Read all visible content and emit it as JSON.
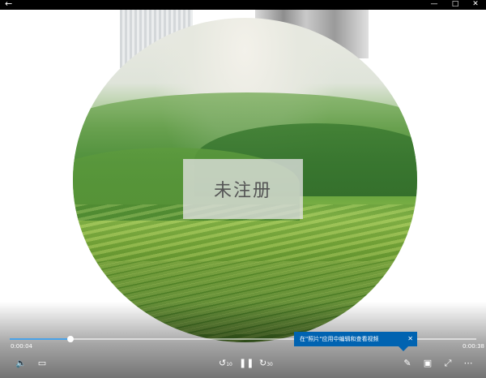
{
  "window": {
    "back_icon": "back-arrow-icon",
    "controls": [
      "minimize-icon",
      "maximize-icon",
      "close-icon"
    ]
  },
  "video": {
    "watermark_text": "未注册"
  },
  "player": {
    "current_time": "0:00:04",
    "total_time": "0:00:38",
    "progress": 0.13,
    "skip_back_label": "10",
    "skip_forward_label": "30"
  },
  "toast": {
    "text": "在\"照片\"应用中编辑和查看视频"
  },
  "colors": {
    "accent": "#0063b1",
    "seek_fill": "#4aa3e8",
    "titlebar": "#000000"
  }
}
